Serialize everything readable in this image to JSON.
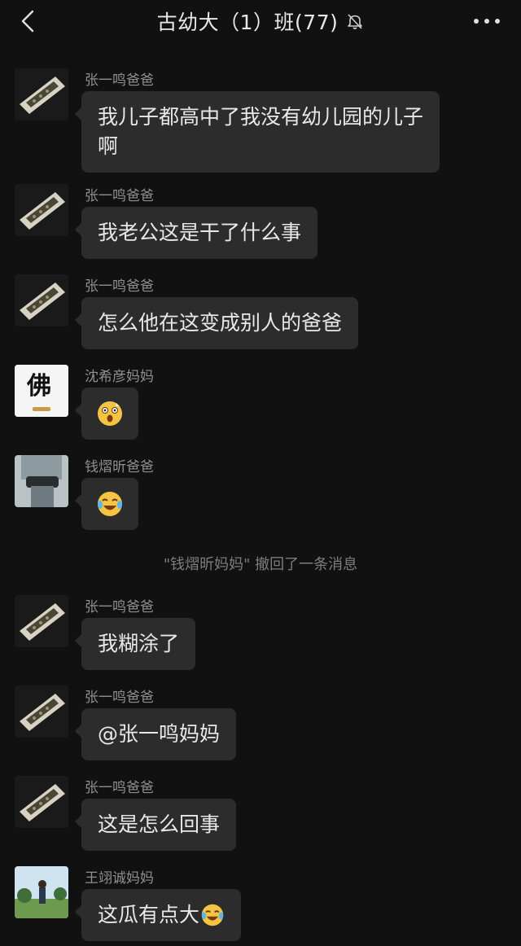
{
  "header": {
    "title": "古幼大（1）班(77)"
  },
  "messages": [
    {
      "sender": "张一鸣爸爸",
      "text": "我儿子都高中了我没有幼儿园的儿子啊"
    },
    {
      "sender": "张一鸣爸爸",
      "text": "我老公这是干了什么事"
    },
    {
      "sender": "张一鸣爸爸",
      "text": "怎么他在这变成别人的爸爸"
    },
    {
      "sender": "沈希彦妈妈",
      "emoji": "surprised-emoji",
      "avatar_text": "佛"
    },
    {
      "sender": "钱熠昕爸爸",
      "emoji": "laugh-cry-emoji"
    },
    {
      "sender": "张一鸣爸爸",
      "text": "我糊涂了"
    },
    {
      "sender": "张一鸣爸爸",
      "text": "@张一鸣妈妈"
    },
    {
      "sender": "张一鸣爸爸",
      "text": "这是怎么回事"
    },
    {
      "sender": "王翊诚妈妈",
      "text": "这瓜有点大"
    }
  ],
  "system_note": "\"钱熠昕妈妈\" 撤回了一条消息",
  "colors": {
    "background": "#111111",
    "bubble": "#2c2c2c",
    "text": "#e8e8e8",
    "sender": "#8f8f8f"
  }
}
